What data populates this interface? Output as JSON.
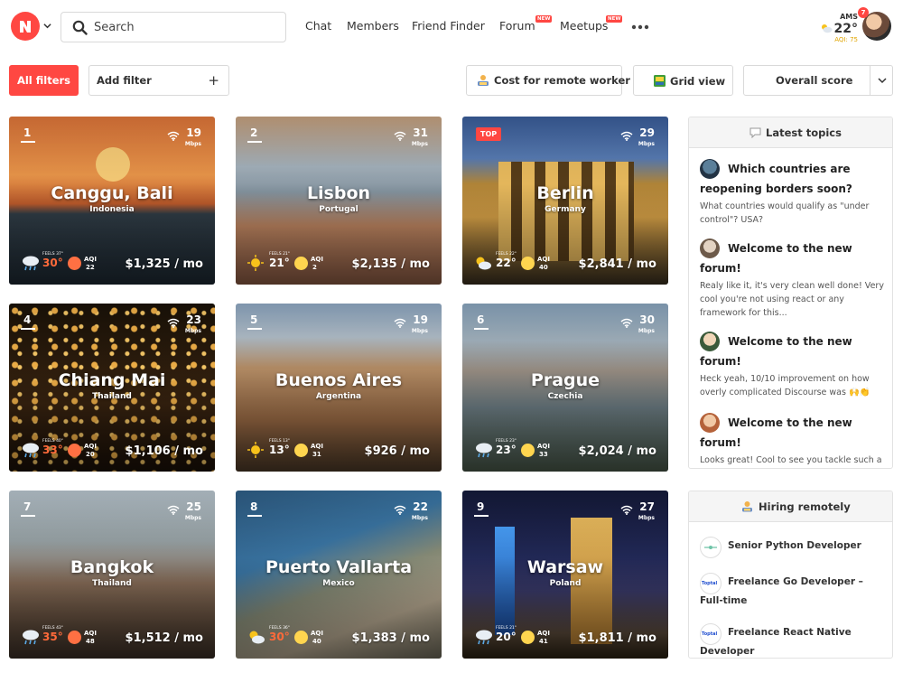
{
  "header": {
    "search_placeholder": "Search",
    "nav": [
      {
        "label": "Chat",
        "badge": ""
      },
      {
        "label": "Members",
        "badge": ""
      },
      {
        "label": "Friend Finder",
        "badge": ""
      },
      {
        "label": "Forum",
        "badge": "NEW"
      },
      {
        "label": "Meetups",
        "badge": "NEW"
      }
    ],
    "weather": {
      "city": "AMS",
      "temp": "22°",
      "aqi": "AQI: 75"
    },
    "notifications": "7"
  },
  "filters": {
    "all_filters": "All filters",
    "add_filter": "Add filter",
    "add_icon": "+",
    "cost_remote_worker": "Cost for remote worker",
    "grid_view": "Grid view",
    "sort": "Overall score"
  },
  "colors": {
    "accent": "#ff4742",
    "hot": "#ff6a3a",
    "mild": "#ffffff"
  },
  "cities": [
    {
      "rank": "1",
      "name": "Canggu, Bali",
      "country": "Indonesia",
      "speed": "19",
      "unit": "Mbps",
      "feels": "FEELS 37°",
      "temp": "30°",
      "temp_color": "#ff6a3a",
      "aqi_label": "AQI",
      "aqi": "22",
      "cost": "$1,325 / mo",
      "weather_icon": "rain-cloud-icon"
    },
    {
      "rank": "2",
      "name": "Lisbon",
      "country": "Portugal",
      "speed": "31",
      "unit": "Mbps",
      "feels": "FEELS 21°",
      "temp": "21°",
      "temp_color": "#ffffff",
      "aqi_label": "AQI",
      "aqi": "2",
      "cost": "$2,135 / mo",
      "weather_icon": "sun-icon"
    },
    {
      "rank": "TOP",
      "name": "Berlin",
      "country": "Germany",
      "speed": "29",
      "unit": "Mbps",
      "feels": "FEELS 22°",
      "temp": "22°",
      "temp_color": "#ffffff",
      "aqi_label": "AQI",
      "aqi": "40",
      "cost": "$2,841 / mo",
      "weather_icon": "partly-cloudy-icon"
    },
    {
      "rank": "4",
      "name": "Chiang Mai",
      "country": "Thailand",
      "speed": "23",
      "unit": "Mbps",
      "feels": "FEELS 40°",
      "temp": "33°",
      "temp_color": "#ff6a3a",
      "aqi_label": "AQI",
      "aqi": "20",
      "cost": "$1,106 / mo",
      "weather_icon": "rain-cloud-icon"
    },
    {
      "rank": "5",
      "name": "Buenos Aires",
      "country": "Argentina",
      "speed": "19",
      "unit": "Mbps",
      "feels": "FEELS 13°",
      "temp": "13°",
      "temp_color": "#ffffff",
      "aqi_label": "AQI",
      "aqi": "31",
      "cost": "$926 / mo",
      "weather_icon": "sun-icon"
    },
    {
      "rank": "6",
      "name": "Prague",
      "country": "Czechia",
      "speed": "30",
      "unit": "Mbps",
      "feels": "FEELS 23°",
      "temp": "23°",
      "temp_color": "#ffffff",
      "aqi_label": "AQI",
      "aqi": "33",
      "cost": "$2,024 / mo",
      "weather_icon": "rain-cloud-icon"
    },
    {
      "rank": "7",
      "name": "Bangkok",
      "country": "Thailand",
      "speed": "25",
      "unit": "Mbps",
      "feels": "FEELS 43°",
      "temp": "35°",
      "temp_color": "#ff6a3a",
      "aqi_label": "AQI",
      "aqi": "48",
      "cost": "$1,512 / mo",
      "weather_icon": "rain-cloud-icon"
    },
    {
      "rank": "8",
      "name": "Puerto Vallarta",
      "country": "Mexico",
      "speed": "22",
      "unit": "Mbps",
      "feels": "FEELS 36°",
      "temp": "30°",
      "temp_color": "#ff6a3a",
      "aqi_label": "AQI",
      "aqi": "40",
      "cost": "$1,383 / mo",
      "weather_icon": "partly-cloudy-icon"
    },
    {
      "rank": "9",
      "name": "Warsaw",
      "country": "Poland",
      "speed": "27",
      "unit": "Mbps",
      "feels": "FEELS 21°",
      "temp": "20°",
      "temp_color": "#ffffff",
      "aqi_label": "AQI",
      "aqi": "41",
      "cost": "$1,811 / mo",
      "weather_icon": "rain-cloud-icon"
    }
  ],
  "latest_topics": {
    "title": "Latest topics",
    "items": [
      {
        "title": "Which countries are reopening borders soon?",
        "excerpt": "What countries would qualify as \"under control\"? USA?"
      },
      {
        "title": "Welcome to the new forum!",
        "excerpt": "Realy like it, it's very clean well done! Very cool you're not using react or any framework for this..."
      },
      {
        "title": "Welcome to the new forum!",
        "excerpt": "Heck yeah, 10/10 improvement on how overly complicated Discourse was 🙌👏"
      },
      {
        "title": "Welcome to the new forum!",
        "excerpt": "Looks great! Cool to see you tackle such a"
      }
    ]
  },
  "hiring": {
    "title": "Hiring remotely",
    "jobs": [
      {
        "title": "Senior Python Developer",
        "logo": ""
      },
      {
        "title": "Freelance Go Developer – Full-time",
        "logo": "Toptal"
      },
      {
        "title": "Freelance React Native Developer",
        "logo": "Toptal"
      }
    ]
  }
}
